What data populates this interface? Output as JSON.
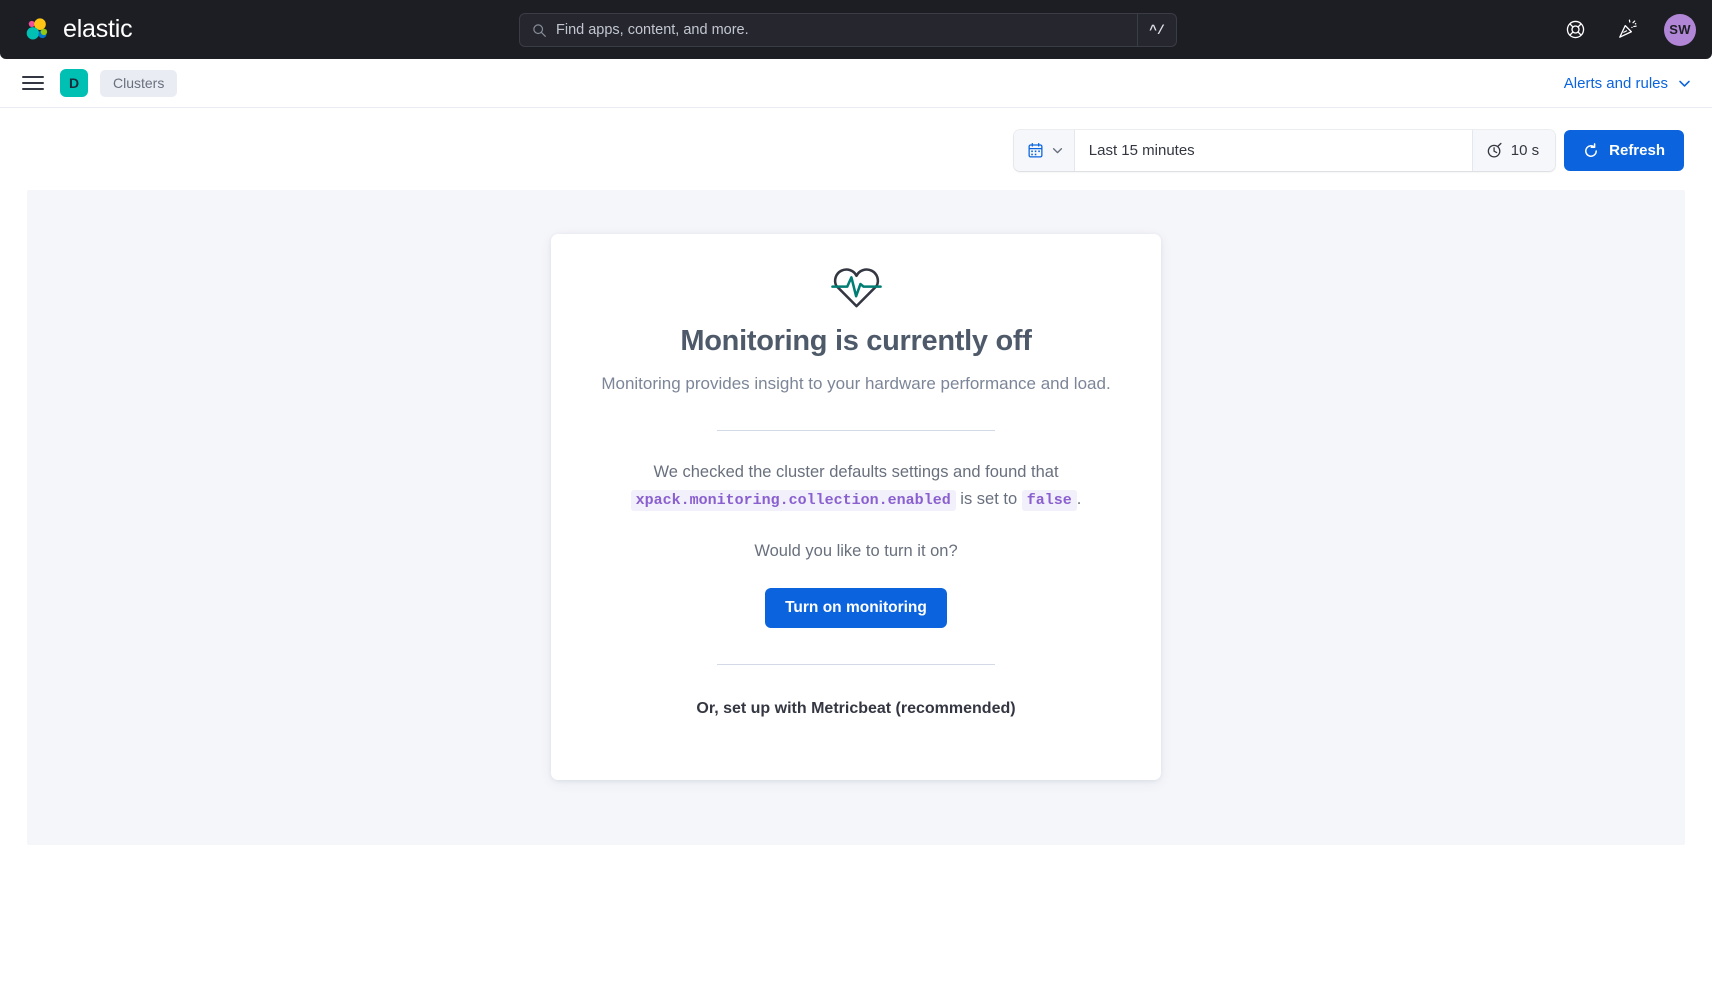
{
  "header": {
    "brand_name": "elastic",
    "brand_logo_icon": "elastic-logo-icon",
    "search": {
      "placeholder": "Find apps, content, and more.",
      "value": "",
      "icon": "search-icon",
      "shortcut": "^/"
    },
    "help_icon": "lifebuoy-help-icon",
    "news_icon": "announcement-party-popper-icon",
    "avatar_initials": "SW",
    "avatar_color": "#b186d6",
    "background_color": "#1d1e24"
  },
  "subnav": {
    "menu_icon": "hamburger-menu-icon",
    "space_initial": "D",
    "space_color": "#00bfb3",
    "breadcrumb": "Clusters",
    "alerts_and_rules": "Alerts and rules",
    "alerts_chevron_icon": "chevron-down-icon",
    "link_color": "#0b64dd"
  },
  "controls": {
    "calendar_icon": "calendar-icon",
    "calendar_chevron_icon": "chevron-down-icon",
    "date_range": "Last 15 minutes",
    "date_range_placeholder": "Last 15 minutes",
    "refresh_interval_icon": "refresh-interval-clock-icon",
    "refresh_interval": "10 s",
    "refresh_icon": "refresh-circle-arrow-icon",
    "refresh_label": "Refresh",
    "primary_color": "#0b64dd"
  },
  "card": {
    "icon": "heart-pulse-monitoring-icon",
    "icon_accent_color": "#017d73",
    "title": "Monitoring is currently off",
    "subtitle": "Monitoring provides insight to your hardware performance and load.",
    "check_text_before": "We checked the cluster defaults settings and found that",
    "setting_key": "xpack.monitoring.collection.enabled",
    "check_text_middle": "is set to",
    "setting_value": "false",
    "check_text_after": ".",
    "question": "Would you like to turn it on?",
    "turn_on_label": "Turn on monitoring",
    "metricbeat_label": "Or, set up with Metricbeat (recommended)",
    "code_color": "#8a5fcf",
    "code_background": "#f1f0fb"
  },
  "page": {
    "panel_background": "#f5f6fa",
    "card_background": "#ffffff"
  }
}
